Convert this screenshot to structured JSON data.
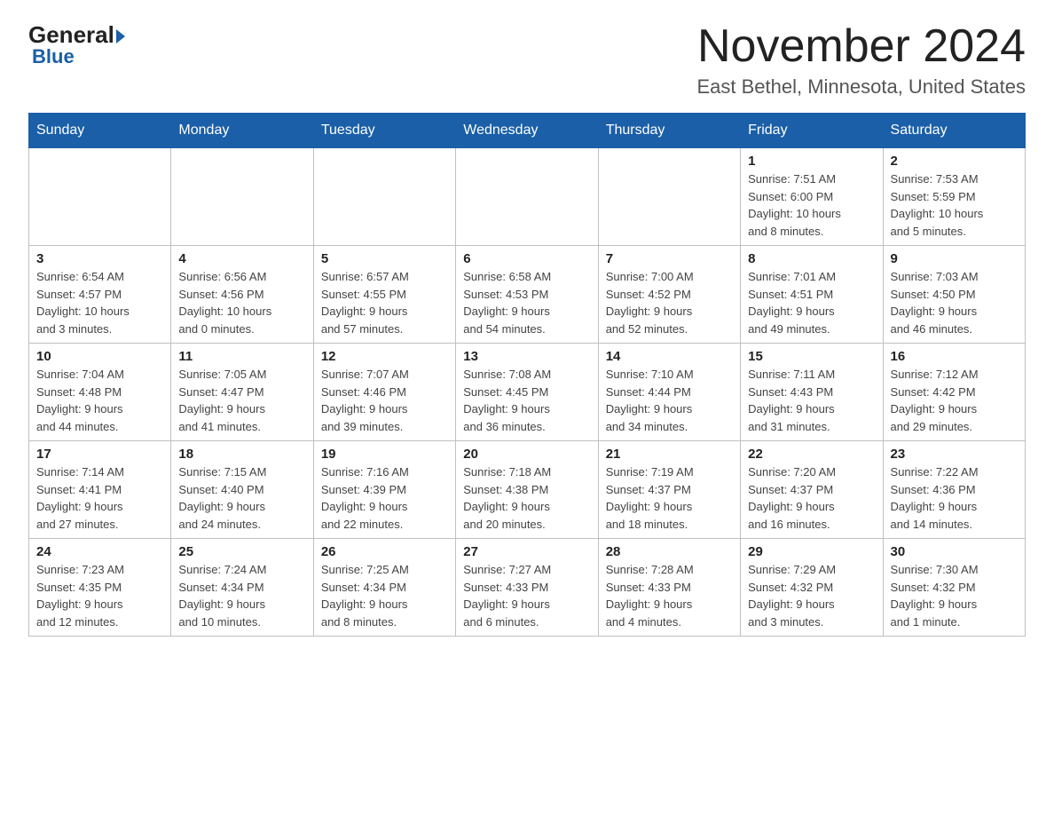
{
  "header": {
    "logo_general": "General",
    "logo_blue": "Blue",
    "title": "November 2024",
    "subtitle": "East Bethel, Minnesota, United States"
  },
  "calendar": {
    "days_of_week": [
      "Sunday",
      "Monday",
      "Tuesday",
      "Wednesday",
      "Thursday",
      "Friday",
      "Saturday"
    ],
    "weeks": [
      [
        {
          "day": "",
          "info": ""
        },
        {
          "day": "",
          "info": ""
        },
        {
          "day": "",
          "info": ""
        },
        {
          "day": "",
          "info": ""
        },
        {
          "day": "",
          "info": ""
        },
        {
          "day": "1",
          "info": "Sunrise: 7:51 AM\nSunset: 6:00 PM\nDaylight: 10 hours\nand 8 minutes."
        },
        {
          "day": "2",
          "info": "Sunrise: 7:53 AM\nSunset: 5:59 PM\nDaylight: 10 hours\nand 5 minutes."
        }
      ],
      [
        {
          "day": "3",
          "info": "Sunrise: 6:54 AM\nSunset: 4:57 PM\nDaylight: 10 hours\nand 3 minutes."
        },
        {
          "day": "4",
          "info": "Sunrise: 6:56 AM\nSunset: 4:56 PM\nDaylight: 10 hours\nand 0 minutes."
        },
        {
          "day": "5",
          "info": "Sunrise: 6:57 AM\nSunset: 4:55 PM\nDaylight: 9 hours\nand 57 minutes."
        },
        {
          "day": "6",
          "info": "Sunrise: 6:58 AM\nSunset: 4:53 PM\nDaylight: 9 hours\nand 54 minutes."
        },
        {
          "day": "7",
          "info": "Sunrise: 7:00 AM\nSunset: 4:52 PM\nDaylight: 9 hours\nand 52 minutes."
        },
        {
          "day": "8",
          "info": "Sunrise: 7:01 AM\nSunset: 4:51 PM\nDaylight: 9 hours\nand 49 minutes."
        },
        {
          "day": "9",
          "info": "Sunrise: 7:03 AM\nSunset: 4:50 PM\nDaylight: 9 hours\nand 46 minutes."
        }
      ],
      [
        {
          "day": "10",
          "info": "Sunrise: 7:04 AM\nSunset: 4:48 PM\nDaylight: 9 hours\nand 44 minutes."
        },
        {
          "day": "11",
          "info": "Sunrise: 7:05 AM\nSunset: 4:47 PM\nDaylight: 9 hours\nand 41 minutes."
        },
        {
          "day": "12",
          "info": "Sunrise: 7:07 AM\nSunset: 4:46 PM\nDaylight: 9 hours\nand 39 minutes."
        },
        {
          "day": "13",
          "info": "Sunrise: 7:08 AM\nSunset: 4:45 PM\nDaylight: 9 hours\nand 36 minutes."
        },
        {
          "day": "14",
          "info": "Sunrise: 7:10 AM\nSunset: 4:44 PM\nDaylight: 9 hours\nand 34 minutes."
        },
        {
          "day": "15",
          "info": "Sunrise: 7:11 AM\nSunset: 4:43 PM\nDaylight: 9 hours\nand 31 minutes."
        },
        {
          "day": "16",
          "info": "Sunrise: 7:12 AM\nSunset: 4:42 PM\nDaylight: 9 hours\nand 29 minutes."
        }
      ],
      [
        {
          "day": "17",
          "info": "Sunrise: 7:14 AM\nSunset: 4:41 PM\nDaylight: 9 hours\nand 27 minutes."
        },
        {
          "day": "18",
          "info": "Sunrise: 7:15 AM\nSunset: 4:40 PM\nDaylight: 9 hours\nand 24 minutes."
        },
        {
          "day": "19",
          "info": "Sunrise: 7:16 AM\nSunset: 4:39 PM\nDaylight: 9 hours\nand 22 minutes."
        },
        {
          "day": "20",
          "info": "Sunrise: 7:18 AM\nSunset: 4:38 PM\nDaylight: 9 hours\nand 20 minutes."
        },
        {
          "day": "21",
          "info": "Sunrise: 7:19 AM\nSunset: 4:37 PM\nDaylight: 9 hours\nand 18 minutes."
        },
        {
          "day": "22",
          "info": "Sunrise: 7:20 AM\nSunset: 4:37 PM\nDaylight: 9 hours\nand 16 minutes."
        },
        {
          "day": "23",
          "info": "Sunrise: 7:22 AM\nSunset: 4:36 PM\nDaylight: 9 hours\nand 14 minutes."
        }
      ],
      [
        {
          "day": "24",
          "info": "Sunrise: 7:23 AM\nSunset: 4:35 PM\nDaylight: 9 hours\nand 12 minutes."
        },
        {
          "day": "25",
          "info": "Sunrise: 7:24 AM\nSunset: 4:34 PM\nDaylight: 9 hours\nand 10 minutes."
        },
        {
          "day": "26",
          "info": "Sunrise: 7:25 AM\nSunset: 4:34 PM\nDaylight: 9 hours\nand 8 minutes."
        },
        {
          "day": "27",
          "info": "Sunrise: 7:27 AM\nSunset: 4:33 PM\nDaylight: 9 hours\nand 6 minutes."
        },
        {
          "day": "28",
          "info": "Sunrise: 7:28 AM\nSunset: 4:33 PM\nDaylight: 9 hours\nand 4 minutes."
        },
        {
          "day": "29",
          "info": "Sunrise: 7:29 AM\nSunset: 4:32 PM\nDaylight: 9 hours\nand 3 minutes."
        },
        {
          "day": "30",
          "info": "Sunrise: 7:30 AM\nSunset: 4:32 PM\nDaylight: 9 hours\nand 1 minute."
        }
      ]
    ]
  }
}
